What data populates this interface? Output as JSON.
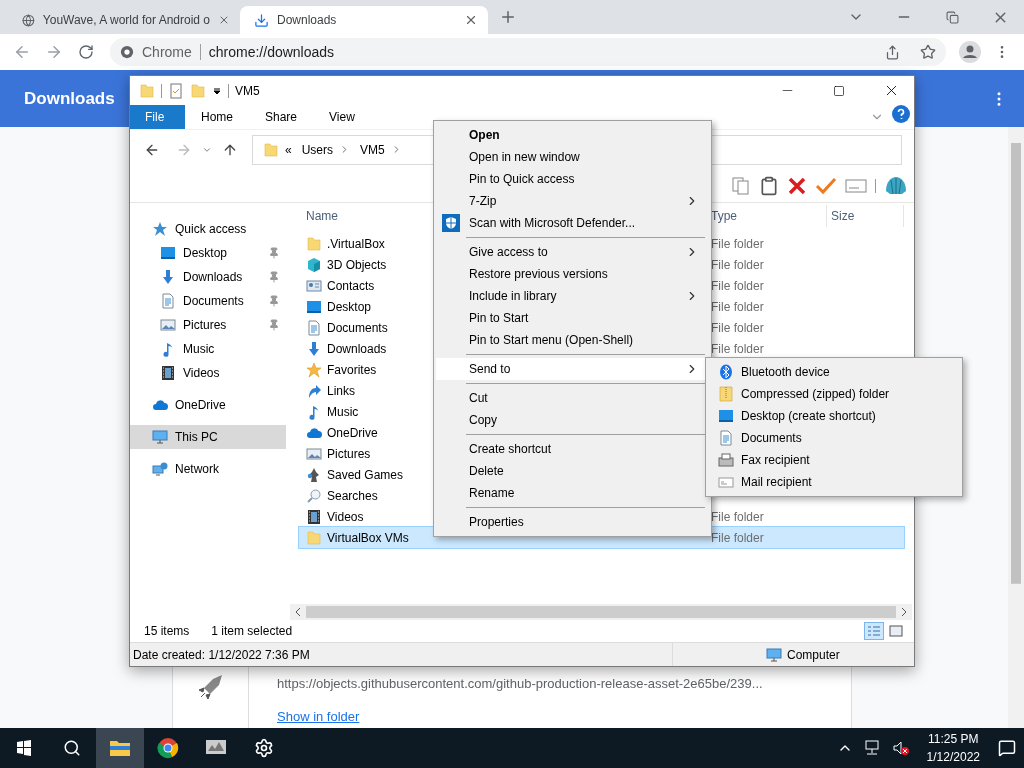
{
  "browser": {
    "tabs": [
      {
        "title": "YouWave, A world for Android o",
        "selected": false
      },
      {
        "title": "Downloads",
        "selected": true
      }
    ],
    "omnibox": {
      "site_label": "Chrome",
      "url": "chrome://downloads"
    },
    "page": {
      "title": "Downloads",
      "download": {
        "url": "https://objects.githubusercontent.com/github-production-release-asset-2e65be/239...",
        "link": "Show in folder"
      }
    }
  },
  "explorer": {
    "title": "VM5",
    "ribbon_tabs": [
      {
        "label": "File",
        "selected": true
      },
      {
        "label": "Home",
        "selected": false
      },
      {
        "label": "Share",
        "selected": false
      },
      {
        "label": "View",
        "selected": false
      }
    ],
    "breadcrumb": {
      "overflow": "«",
      "parts": [
        "Users",
        "VM5"
      ]
    },
    "nav": [
      {
        "label": "Quick access",
        "selected": false,
        "children": [
          {
            "label": "Desktop",
            "pinned": true,
            "selected": false
          },
          {
            "label": "Downloads",
            "pinned": true,
            "selected": false
          },
          {
            "label": "Documents",
            "pinned": true,
            "selected": false
          },
          {
            "label": "Pictures",
            "pinned": true,
            "selected": false
          },
          {
            "label": "Music",
            "pinned": false,
            "selected": false
          },
          {
            "label": "Videos",
            "pinned": false,
            "selected": false
          }
        ]
      },
      {
        "label": "OneDrive",
        "selected": false
      },
      {
        "label": "This PC",
        "selected": true
      },
      {
        "label": "Network",
        "selected": false
      }
    ],
    "columns": {
      "name": "Name",
      "type": "Type",
      "size": "Size"
    },
    "files": [
      {
        "name": ".VirtualBox",
        "type": "File folder",
        "selected": false
      },
      {
        "name": "3D Objects",
        "type": "File folder",
        "selected": false
      },
      {
        "name": "Contacts",
        "type": "File folder",
        "selected": false
      },
      {
        "name": "Desktop",
        "type": "File folder",
        "selected": false
      },
      {
        "name": "Documents",
        "type": "File folder",
        "selected": false
      },
      {
        "name": "Downloads",
        "type": "File folder",
        "selected": false
      },
      {
        "name": "Favorites",
        "selected": false
      },
      {
        "name": "Links",
        "selected": false
      },
      {
        "name": "Music",
        "selected": false
      },
      {
        "name": "OneDrive",
        "selected": false
      },
      {
        "name": "Pictures",
        "selected": false
      },
      {
        "name": "Saved Games",
        "selected": false
      },
      {
        "name": "Searches",
        "selected": false
      },
      {
        "name": "Videos",
        "type": "File folder",
        "selected": false
      },
      {
        "name": "VirtualBox VMs",
        "type": "File folder",
        "selected": true
      }
    ],
    "status": {
      "count": "15 items",
      "selection": "1 item selected"
    },
    "details": {
      "info": "Date created: 1/12/2022 7:36 PM",
      "location": "Computer"
    }
  },
  "context_menu": [
    {
      "kind": "item",
      "label": "Open",
      "default": true,
      "submenu": false,
      "highlighted": false
    },
    {
      "kind": "item",
      "label": "Open in new window",
      "default": false,
      "submenu": false,
      "highlighted": false
    },
    {
      "kind": "item",
      "label": "Pin to Quick access",
      "default": false,
      "submenu": false,
      "highlighted": false
    },
    {
      "kind": "item",
      "label": "7-Zip",
      "default": false,
      "submenu": true,
      "highlighted": false
    },
    {
      "kind": "item",
      "label": "Scan with Microsoft Defender...",
      "default": false,
      "submenu": false,
      "highlighted": false
    },
    {
      "kind": "separator"
    },
    {
      "kind": "item",
      "label": "Give access to",
      "default": false,
      "submenu": true,
      "highlighted": false
    },
    {
      "kind": "item",
      "label": "Restore previous versions",
      "default": false,
      "submenu": false,
      "highlighted": false
    },
    {
      "kind": "item",
      "label": "Include in library",
      "default": false,
      "submenu": true,
      "highlighted": false
    },
    {
      "kind": "item",
      "label": "Pin to Start",
      "default": false,
      "submenu": false,
      "highlighted": false
    },
    {
      "kind": "item",
      "label": "Pin to Start menu (Open-Shell)",
      "default": false,
      "submenu": false,
      "highlighted": false
    },
    {
      "kind": "separator"
    },
    {
      "kind": "item",
      "label": "Send to",
      "default": false,
      "submenu": true,
      "highlighted": true
    },
    {
      "kind": "separator"
    },
    {
      "kind": "item",
      "label": "Cut",
      "default": false,
      "submenu": false,
      "highlighted": false
    },
    {
      "kind": "item",
      "label": "Copy",
      "default": false,
      "submenu": false,
      "highlighted": false
    },
    {
      "kind": "separator"
    },
    {
      "kind": "item",
      "label": "Create shortcut",
      "default": false,
      "submenu": false,
      "highlighted": false
    },
    {
      "kind": "item",
      "label": "Delete",
      "default": false,
      "submenu": false,
      "highlighted": false
    },
    {
      "kind": "item",
      "label": "Rename",
      "default": false,
      "submenu": false,
      "highlighted": false
    },
    {
      "kind": "separator"
    },
    {
      "kind": "item",
      "label": "Properties",
      "default": false,
      "submenu": false,
      "highlighted": false
    }
  ],
  "send_to": [
    "Bluetooth device",
    "Compressed (zipped) folder",
    "Desktop (create shortcut)",
    "Documents",
    "Fax recipient",
    "Mail recipient"
  ],
  "taskbar": {
    "apps": [
      {
        "active": false
      },
      {
        "active": true
      },
      {
        "active": false
      },
      {
        "active": false
      },
      {
        "active": false
      }
    ],
    "time": "11:25 PM",
    "date": "1/12/2022"
  }
}
